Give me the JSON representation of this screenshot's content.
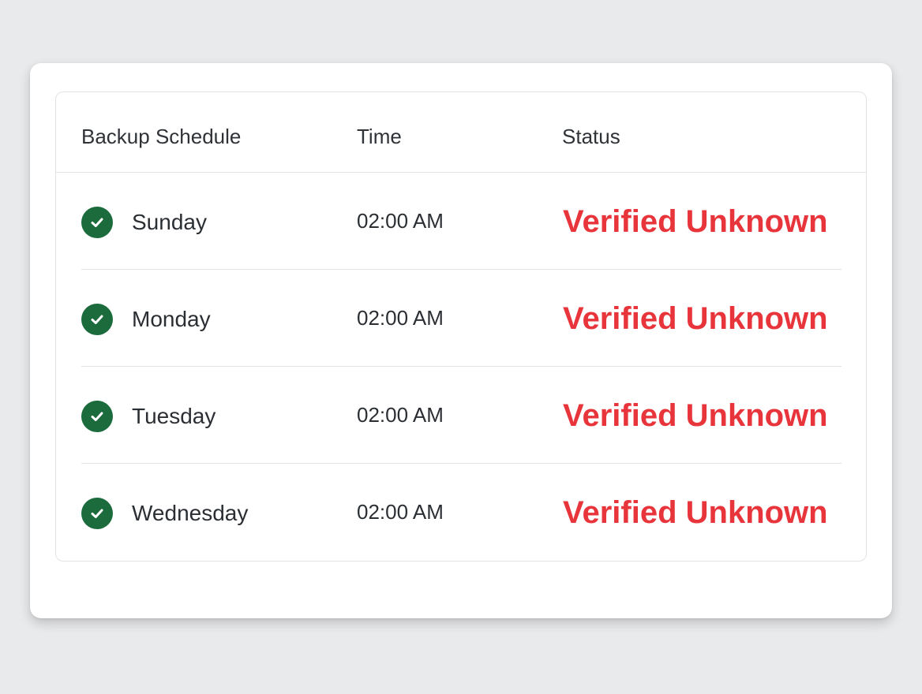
{
  "table": {
    "columns": {
      "schedule": "Backup Schedule",
      "time": "Time",
      "status": "Status"
    },
    "rows": [
      {
        "day": "Sunday",
        "time": "02:00 AM",
        "status": "Verified Unknown",
        "icon": "check-circle-icon"
      },
      {
        "day": "Monday",
        "time": "02:00 AM",
        "status": "Verified Unknown",
        "icon": "check-circle-icon"
      },
      {
        "day": "Tuesday",
        "time": "02:00 AM",
        "status": "Verified Unknown",
        "icon": "check-circle-icon"
      },
      {
        "day": "Wednesday",
        "time": "02:00 AM",
        "status": "Verified Unknown",
        "icon": "check-circle-icon"
      }
    ]
  },
  "colors": {
    "check": "#1b6b3c",
    "status": "#e8353b",
    "background": "#e9eaec"
  }
}
